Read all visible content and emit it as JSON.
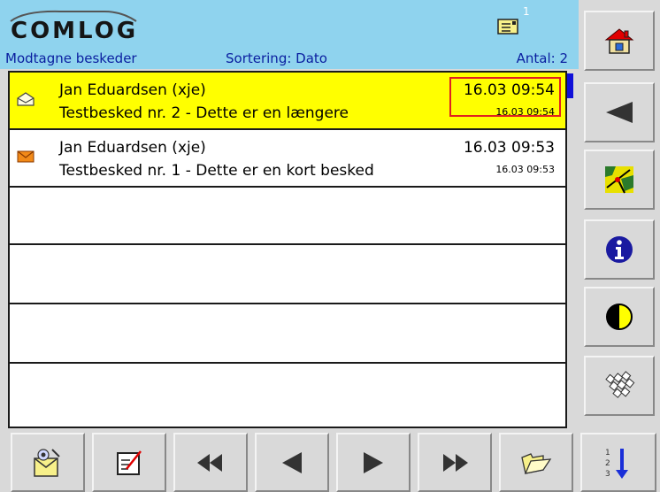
{
  "header": {
    "logo_text": "COMLOG",
    "message_count_badge": "1",
    "title": "Modtagne beskeder",
    "sort_label": "Sortering: Dato",
    "count_label": "Antal: 2",
    "background_color": "#8fd3ee",
    "text_color": "#0a1fa0"
  },
  "messages": [
    {
      "sender": "Jan Eduardsen (xje)",
      "subject": "Testbesked nr. 2 - Dette er en længere",
      "time": "16.03 09:54",
      "time_small": "16.03 09:54",
      "status": "read",
      "icon": "open-envelope-icon",
      "selected": true
    },
    {
      "sender": "Jan Eduardsen (xje)",
      "subject": "Testbesked nr. 1 - Dette er en kort besked",
      "time": "16.03 09:53",
      "time_small": "16.03 09:53",
      "status": "unread",
      "icon": "closed-envelope-icon",
      "selected": false
    }
  ],
  "colors": {
    "selected_row": "#ffff00",
    "highlight_border": "#e02020",
    "scrollbar": "#1010d8"
  },
  "side_buttons": [
    "home-icon",
    "back-arrow-icon",
    "map-icon",
    "info-icon",
    "contrast-icon",
    "keyboard-icon"
  ],
  "bottom_buttons": [
    "envelope-user-icon",
    "new-message-icon",
    "first-page-icon",
    "previous-icon",
    "next-icon",
    "last-page-icon",
    "folder-icon",
    "sort-descending-icon"
  ]
}
